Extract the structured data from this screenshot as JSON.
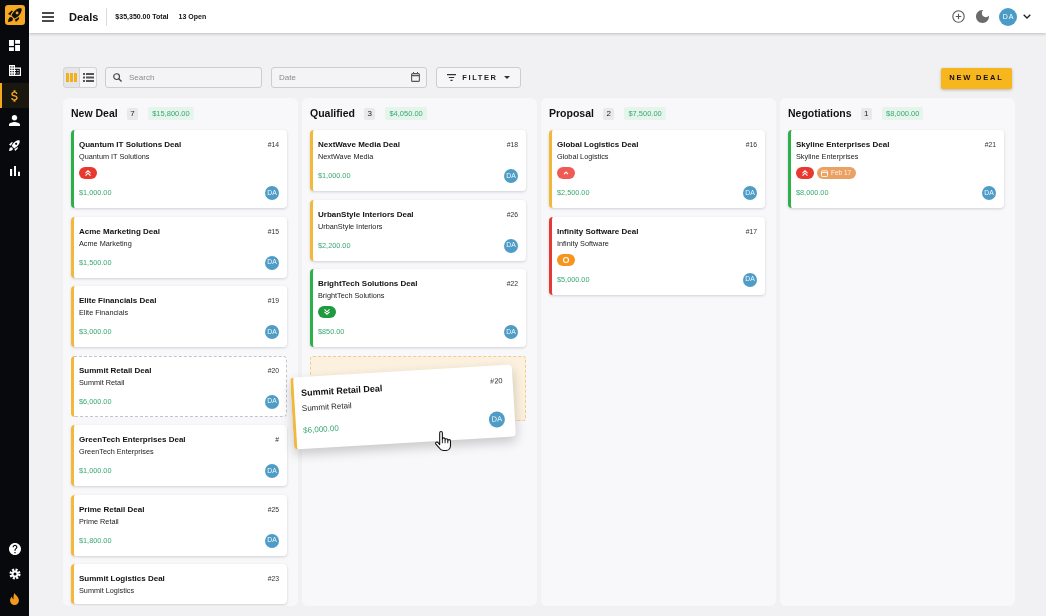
{
  "sidebar": {
    "items": [
      {
        "selected": false
      },
      {
        "selected": false
      },
      {
        "selected": true
      },
      {
        "selected": false
      },
      {
        "selected": false
      },
      {
        "selected": false
      }
    ]
  },
  "header": {
    "title": "Deals",
    "total": "$35,350.00 Total",
    "open": "13 Open",
    "avatar": "DA"
  },
  "toolbar": {
    "views": [
      {
        "selected": true
      },
      {
        "selected": false
      }
    ],
    "search": {
      "placeholder": "Search"
    },
    "date": {
      "placeholder": "Date"
    },
    "filter": "FILTER",
    "new_deal": "NEW DEAL"
  },
  "columns": [
    {
      "title": "New Deal",
      "count": "7",
      "amount": "$15,800.00",
      "drop_placeholder": false,
      "cards": [
        {
          "title": "Quantum IT Solutions Deal",
          "company": "Quantum IT Solutions",
          "number": "#14",
          "priority": {
            "kind": "urgent"
          },
          "amount": "$1,000.00",
          "avatar": "DA",
          "color": "#2bb04a",
          "dragging": false
        },
        {
          "title": "Acme Marketing Deal",
          "company": "Acme Marketing",
          "number": "#15",
          "amount": "$1,500.00",
          "avatar": "DA",
          "color": "#f2b83a",
          "dragging": false
        },
        {
          "title": "Elite Financials Deal",
          "company": "Elite Financials",
          "number": "#19",
          "amount": "$3,000.00",
          "avatar": "DA",
          "color": "#f2b83a",
          "dragging": false
        },
        {
          "title": "Summit Retail Deal",
          "company": "Summit Retail",
          "number": "#20",
          "amount": "$6,000.00",
          "avatar": "DA",
          "color": "#f2b83a",
          "dragging": true
        },
        {
          "title": "GreenTech Enterprises Deal",
          "company": "GreenTech Enterprises",
          "number": "#",
          "amount": "$1,000.00",
          "avatar": "DA",
          "color": "#f2b83a",
          "dragging": false
        },
        {
          "title": "Prime Retail Deal",
          "company": "Prime Retail",
          "number": "#25",
          "amount": "$1,800.00",
          "avatar": "DA",
          "color": "#f2b83a",
          "dragging": false
        },
        {
          "title": "Summit Logistics Deal",
          "company": "Summit Logistics",
          "number": "#23",
          "color": "#f2b83a",
          "dragging": false
        }
      ]
    },
    {
      "title": "Qualified",
      "count": "3",
      "amount": "$4,050.00",
      "drop_placeholder": true,
      "cards": [
        {
          "title": "NextWave Media Deal",
          "company": "NextWave Media",
          "number": "#18",
          "amount": "$1,000.00",
          "avatar": "DA",
          "color": "#f2b83a",
          "dragging": false
        },
        {
          "title": "UrbanStyle Interiors Deal",
          "company": "UrbanStyle Interiors",
          "number": "#26",
          "amount": "$2,200.00",
          "avatar": "DA",
          "color": "#f2b83a",
          "dragging": false
        },
        {
          "title": "BrightTech Solutions Deal",
          "company": "BrightTech Solutions",
          "number": "#22",
          "priority": {
            "kind": "low"
          },
          "amount": "$850.00",
          "avatar": "DA",
          "color": "#2bb04a",
          "dragging": false
        }
      ]
    },
    {
      "title": "Proposal",
      "count": "2",
      "amount": "$7,500.00",
      "drop_placeholder": false,
      "cards": [
        {
          "title": "Global Logistics Deal",
          "company": "Global Logistics",
          "number": "#16",
          "priority": {
            "kind": "high"
          },
          "amount": "$2,500.00",
          "avatar": "DA",
          "color": "#f2b83a",
          "dragging": false
        },
        {
          "title": "Infinity Software Deal",
          "company": "Infinity Software",
          "number": "#17",
          "priority": {
            "kind": "medium"
          },
          "amount": "$5,000.00",
          "avatar": "DA",
          "color": "#e53935",
          "dragging": false
        }
      ]
    },
    {
      "title": "Negotiations",
      "count": "1",
      "amount": "$8,000.00",
      "drop_placeholder": false,
      "cards": [
        {
          "title": "Skyline Enterprises Deal",
          "company": "Skyline Enterprises",
          "number": "#21",
          "priority": {
            "kind": "urgent"
          },
          "due": "Feb 17",
          "amount": "$8,000.00",
          "avatar": "DA",
          "color": "#2bb04a",
          "dragging": false
        }
      ]
    }
  ],
  "drag_preview": {
    "title": "Summit Retail Deal",
    "company": "Summit Retail",
    "number": "#20",
    "amount": "$6,000.00",
    "avatar": "DA",
    "color": "#f2b83a"
  }
}
